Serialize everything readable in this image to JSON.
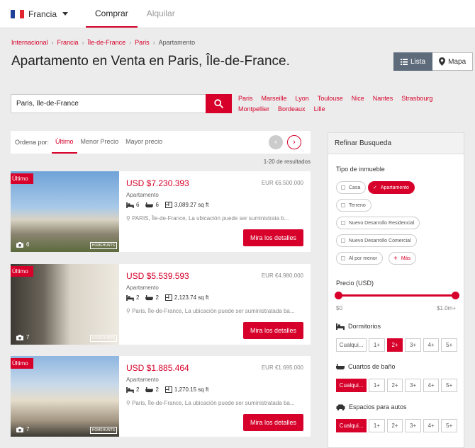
{
  "topbar": {
    "country": "Francia",
    "tabs": [
      {
        "label": "Comprar",
        "active": true
      },
      {
        "label": "Alquilar",
        "active": false
      }
    ]
  },
  "breadcrumb": {
    "items": [
      "Internacional",
      "Francia",
      "Île-de-France",
      "Paris"
    ],
    "current": "Apartamento"
  },
  "page_title": "Apartamento en Venta en Paris, Île-de-France.",
  "view_toggle": {
    "list": "Lista",
    "map": "Mapa"
  },
  "search": {
    "value": "Paris, Île-de-France"
  },
  "cities": [
    "Paris",
    "Marseille",
    "Lyon",
    "Toulouse",
    "Nice",
    "Nantes",
    "Strasbourg",
    "Montpellier",
    "Bordeaux",
    "Lille"
  ],
  "sort": {
    "label": "Ordena por:",
    "options": [
      "Último",
      "Menor Precio",
      "Mayor precio"
    ],
    "active_index": 0
  },
  "result_count": "1-20 de resultados",
  "listings": [
    {
      "tag": "Último",
      "price": "USD $7.230.393",
      "eur": "EUR €6.500.000",
      "type": "Apartamento",
      "beds": "6",
      "baths": "6",
      "area": "3,089.27 sq ft",
      "location": "PARIS, Île-de-France, La ubicación puede ser suministrata b...",
      "photos": "6",
      "button": "Mira los detalles"
    },
    {
      "tag": "Último",
      "price": "USD $5.539.593",
      "eur": "EUR €4.980.000",
      "type": "Apartamento",
      "beds": "2",
      "baths": "2",
      "area": "2,123.74 sq ft",
      "location": "Paris, Île-de-France, La ubicación puede ser suministratada ba...",
      "photos": "7",
      "button": "Mira los detalles"
    },
    {
      "tag": "Último",
      "price": "USD $1.885.464",
      "eur": "EUR €1.695.000",
      "type": "Apartamento",
      "beds": "2",
      "baths": "2",
      "area": "1,270.15 sq ft",
      "location": "Paris, Île-de-France, La ubicación puede ser suministratada ba...",
      "photos": "7",
      "button": "Mira los detalles"
    }
  ],
  "watermark": "HOMEHUNTS",
  "refine": {
    "title": "Refinar Busqueda",
    "type_label": "Tipo de inmueble",
    "types": [
      {
        "label": "Casa",
        "active": false
      },
      {
        "label": "Apartamento",
        "active": true
      },
      {
        "label": "Terreno",
        "active": false
      },
      {
        "label": "Nuevo Desarrollo Residencial",
        "active": false
      },
      {
        "label": "Nuevo Desarrollo Comercial",
        "active": false
      },
      {
        "label": "Al por menor",
        "active": false
      }
    ],
    "more_label": "Más",
    "price_label": "Precio (USD)",
    "price_min": "$0",
    "price_max": "$1.0m+",
    "bedrooms_label": "Dormitorios",
    "bedrooms": {
      "options": [
        "Cualqui...",
        "1+",
        "2+",
        "3+",
        "4+",
        "5+"
      ],
      "active": 2
    },
    "bathrooms_label": "Cuartos de baño",
    "bathrooms": {
      "options": [
        "Cualqui...",
        "1+",
        "2+",
        "3+",
        "4+",
        "5+"
      ],
      "active": 0
    },
    "parking_label": "Espacios para autos",
    "parking": {
      "options": [
        "Cualqui...",
        "1+",
        "2+",
        "3+",
        "4+",
        "5+"
      ],
      "active": 0
    }
  },
  "colors": {
    "accent": "#d6002a",
    "toggle_active": "#5d6b7a"
  }
}
